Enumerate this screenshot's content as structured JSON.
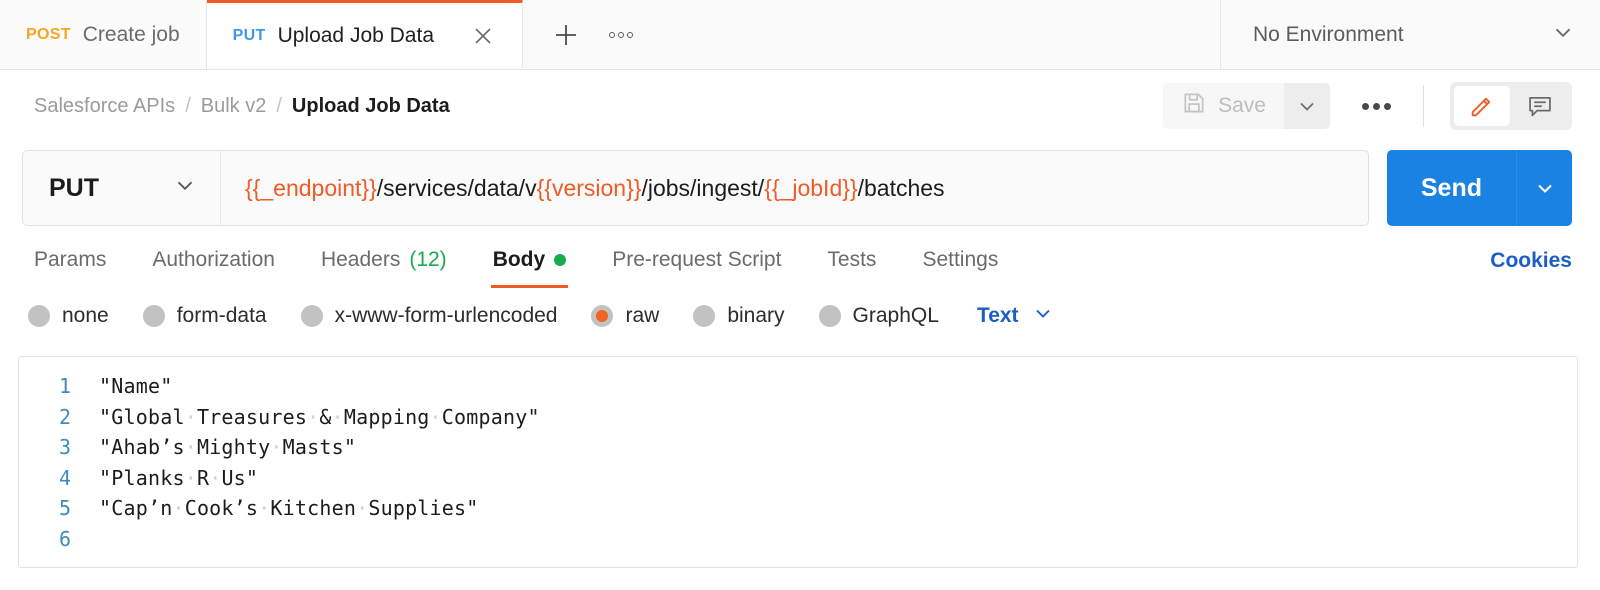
{
  "tabbar": {
    "tabs": [
      {
        "method": "POST",
        "title": "Create job",
        "active": false
      },
      {
        "method": "PUT",
        "title": "Upload Job Data",
        "active": true
      }
    ],
    "new_tab_label": "+",
    "more_label": "more-tabs",
    "environment": {
      "label": "No Environment"
    }
  },
  "header": {
    "breadcrumb": [
      {
        "label": "Salesforce APIs"
      },
      {
        "label": "Bulk v2"
      },
      {
        "label": "Upload Job Data"
      }
    ],
    "separator": "/",
    "save_label": "Save",
    "save_disabled": true,
    "edit_icon_active": true
  },
  "request": {
    "method": "PUT",
    "url_parts": [
      {
        "text": "{{_endpoint}}",
        "variable": true
      },
      {
        "text": "/services/data/v",
        "variable": false
      },
      {
        "text": "{{version}}",
        "variable": true
      },
      {
        "text": "/jobs/ingest/",
        "variable": false
      },
      {
        "text": "{{_jobId}}",
        "variable": true
      },
      {
        "text": "/batches",
        "variable": false
      }
    ],
    "url_plain": "{{_endpoint}}/services/data/v{{version}}/jobs/ingest/{{_jobId}}/batches",
    "send_label": "Send",
    "tabs": [
      {
        "label": "Params",
        "active": false,
        "count": null,
        "dot": false
      },
      {
        "label": "Authorization",
        "active": false,
        "count": null,
        "dot": false
      },
      {
        "label": "Headers",
        "active": false,
        "count": "(12)",
        "dot": false
      },
      {
        "label": "Body",
        "active": true,
        "count": null,
        "dot": true
      },
      {
        "label": "Pre-request Script",
        "active": false,
        "count": null,
        "dot": false
      },
      {
        "label": "Tests",
        "active": false,
        "count": null,
        "dot": false
      },
      {
        "label": "Settings",
        "active": false,
        "count": null,
        "dot": false
      }
    ],
    "cookies_label": "Cookies"
  },
  "body": {
    "types": [
      {
        "label": "none",
        "selected": false
      },
      {
        "label": "form-data",
        "selected": false
      },
      {
        "label": "x-www-form-urlencoded",
        "selected": false
      },
      {
        "label": "raw",
        "selected": true
      },
      {
        "label": "binary",
        "selected": false
      },
      {
        "label": "GraphQL",
        "selected": false
      }
    ],
    "format_label": "Text",
    "lines": [
      {
        "number": "1",
        "text": "\"Name\""
      },
      {
        "number": "2",
        "text": "\"Global Treasures & Mapping Company\""
      },
      {
        "number": "3",
        "text": "\"Ahab’s Mighty Masts\""
      },
      {
        "number": "4",
        "text": "\"Planks R Us\""
      },
      {
        "number": "5",
        "text": "\"Cap’n Cook’s Kitchen Supplies\""
      },
      {
        "number": "6",
        "text": ""
      }
    ]
  },
  "colors": {
    "accent_orange": "#ef5b25",
    "send_blue": "#1a82e2",
    "link_blue": "#1a5fc4",
    "green": "#1aa951",
    "method_post": "#f5a623",
    "method_put": "#4596e6"
  }
}
